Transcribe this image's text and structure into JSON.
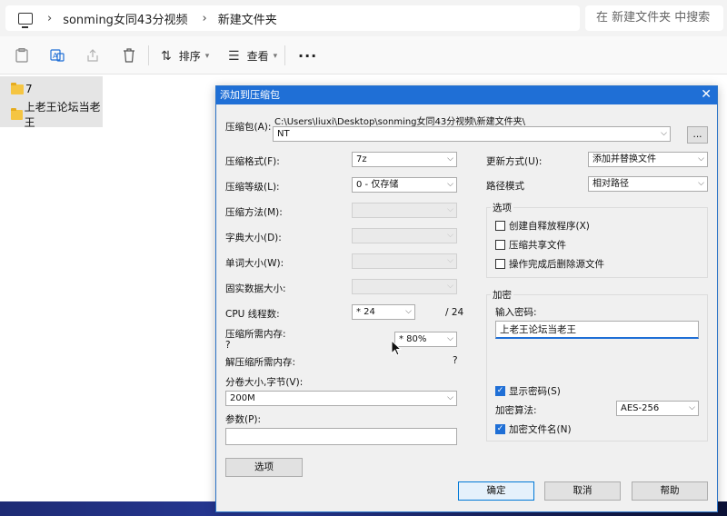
{
  "explorer": {
    "breadcrumb": [
      "sonming女同43分视频",
      "新建文件夹"
    ],
    "search_placeholder": "在 新建文件夹 中搜索",
    "toolbar": {
      "sort_label": "排序",
      "view_label": "查看"
    },
    "files": [
      "7",
      "上老王论坛当老王"
    ]
  },
  "dialog": {
    "title": "添加到压缩包",
    "archive_label": "压缩包(A):",
    "archive_path": "C:\\Users\\liuxi\\Desktop\\sonming女同43分视频\\新建文件夹\\",
    "archive_name": "NT",
    "browse_label": "...",
    "format_label": "压缩格式(F):",
    "format_value": "7z",
    "level_label": "压缩等级(L):",
    "level_value": "0 - 仅存储",
    "method_label": "压缩方法(M):",
    "dict_label": "字典大小(D):",
    "word_label": "单词大小(W):",
    "solid_label": "固实数据大小:",
    "cpu_label": "CPU 线程数:",
    "cpu_value": "* 24",
    "cpu_total": "/ 24",
    "mem_comp_label": "压缩所需内存:",
    "mem_comp_value": "?",
    "mem_pct_value": "* 80%",
    "mem_decomp_label": "解压缩所需内存:",
    "mem_decomp_value": "?",
    "volume_label": "分卷大小,字节(V):",
    "volume_value": "200M",
    "params_label": "参数(P):",
    "params_value": "",
    "options_button": "选项",
    "update_label": "更新方式(U):",
    "update_value": "添加并替换文件",
    "path_mode_label": "路径模式",
    "path_mode_value": "相对路径",
    "options_group": {
      "title": "选项",
      "items": [
        "创建自释放程序(X)",
        "压缩共享文件",
        "操作完成后删除源文件"
      ]
    },
    "encryption": {
      "title": "加密",
      "password_label": "输入密码:",
      "password_value": "上老王论坛当老王",
      "show_password_label": "显示密码(S)",
      "method_label": "加密算法:",
      "method_value": "AES-256",
      "encrypt_names_label": "加密文件名(N)"
    },
    "ok_label": "确定",
    "cancel_label": "取消",
    "help_label": "帮助"
  }
}
